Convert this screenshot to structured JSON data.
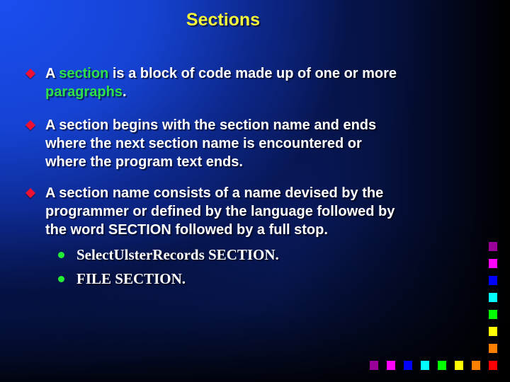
{
  "slide": {
    "title": "Sections",
    "colors": {
      "title": "#f5f53c",
      "highlight": "#2ee04a",
      "bullet_diamond": "#ee1133",
      "sub_bullet_dot": "#22ee33",
      "background_start": "#1a4ef0",
      "background_end": "#000000"
    },
    "bullets": [
      {
        "parts": [
          {
            "text": "A ",
            "highlight": false
          },
          {
            "text": "section",
            "highlight": true
          },
          {
            "text": " is a block of code made up of one or more",
            "highlight": false
          }
        ],
        "line2_parts": [
          {
            "text": "paragraphs",
            "highlight": true
          },
          {
            "text": ".",
            "highlight": false
          }
        ]
      },
      {
        "lines": [
          "A section begins with the section name and ends",
          "where the next section name is encountered or",
          "where the program text ends."
        ]
      },
      {
        "lines": [
          "A section name consists of a name devised by the",
          "programmer or defined by the language followed by",
          "the word SECTION followed by a full stop."
        ],
        "sub_items": [
          "SelectUlsterRecords SECTION.",
          "FILE SECTION."
        ]
      }
    ],
    "decoration": {
      "icon": "color-squares-decoration",
      "square_colors": [
        "#990099",
        "#ff00ff",
        "#0000ff",
        "#00ffff",
        "#00ff00",
        "#ffff00",
        "#ff7f00",
        "#ff0000"
      ]
    }
  }
}
